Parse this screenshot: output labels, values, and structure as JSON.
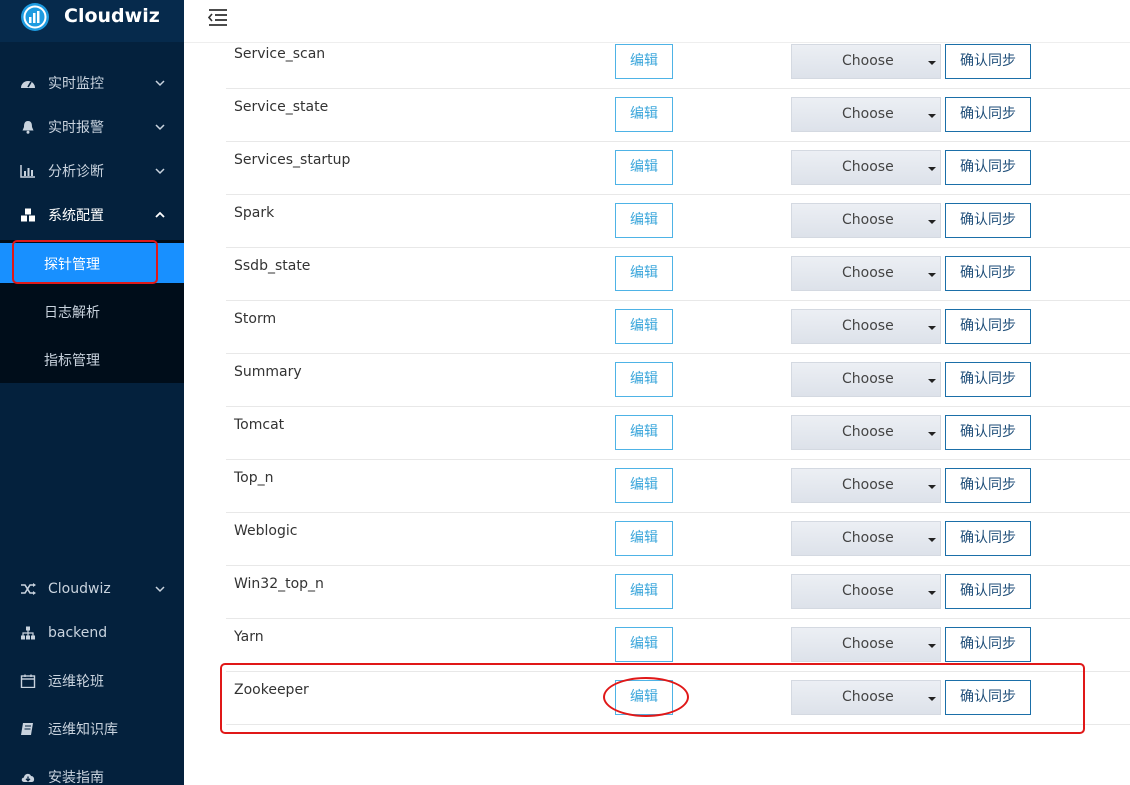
{
  "app": {
    "name": "Cloudwiz"
  },
  "sidebar": {
    "main_items": [
      {
        "label": "实时监控",
        "icon": "dashboard-icon"
      },
      {
        "label": "实时报警",
        "icon": "bell-icon"
      },
      {
        "label": "分析诊断",
        "icon": "bar-chart-icon"
      },
      {
        "label": "系统配置",
        "icon": "cubes-icon"
      }
    ],
    "sub_items": [
      {
        "label": "探针管理",
        "active": true
      },
      {
        "label": "日志解析",
        "active": false
      },
      {
        "label": "指标管理",
        "active": false
      }
    ],
    "bottom_items": [
      {
        "label": "Cloudwiz",
        "icon": "shuffle-icon"
      },
      {
        "label": "backend",
        "icon": "sitemap-icon"
      },
      {
        "label": "运维轮班",
        "icon": "calendar-icon"
      },
      {
        "label": "运维知识库",
        "icon": "book-icon"
      },
      {
        "label": "安装指南",
        "icon": "cloud-download-icon"
      }
    ]
  },
  "table": {
    "edit_label": "编辑",
    "choose_label": "Choose",
    "sync_label": "确认同步",
    "rows": [
      "Service_scan",
      "Service_state",
      "Services_startup",
      "Spark",
      "Ssdb_state",
      "Storm",
      "Summary",
      "Tomcat",
      "Top_n",
      "Weblogic",
      "Win32_top_n",
      "Yarn",
      "Zookeeper"
    ]
  },
  "colors": {
    "sidebar_bg": "#04213d",
    "active_blue": "#1890ff",
    "highlight_red": "#e01818"
  }
}
